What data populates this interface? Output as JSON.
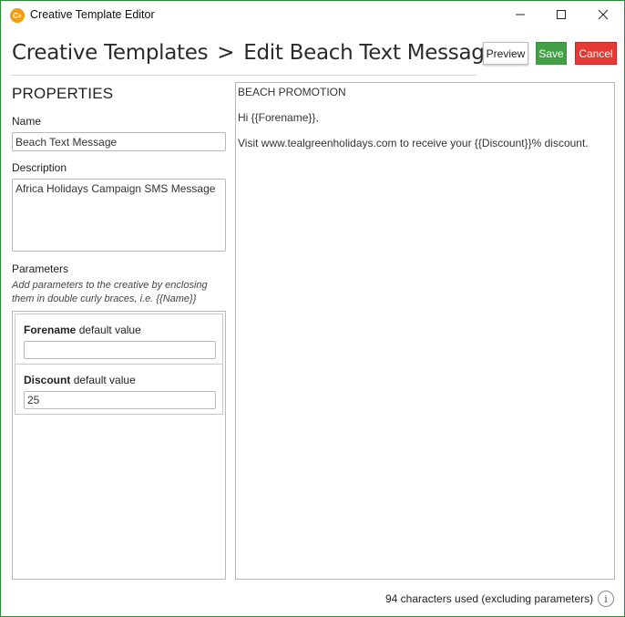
{
  "window": {
    "title": "Creative Template Editor",
    "icon_text": "C+"
  },
  "header": {
    "breadcrumb_root": "Creative Templates",
    "breadcrumb_separator": ">",
    "breadcrumb_current": "Edit Beach Text Message",
    "preview_label": "Preview",
    "save_label": "Save",
    "cancel_label": "Cancel"
  },
  "properties": {
    "heading": "PROPERTIES",
    "name_label": "Name",
    "name_value": "Beach Text Message",
    "description_label": "Description",
    "description_value": "Africa Holidays Campaign SMS Message",
    "parameters_label": "Parameters",
    "parameters_hint": "Add parameters to the creative by enclosing them in double curly braces, i.e. {{Name}}",
    "parameters": [
      {
        "name": "Forename",
        "suffix": "default value",
        "value": ""
      },
      {
        "name": "Discount",
        "suffix": "default value",
        "value": "25"
      }
    ]
  },
  "message": {
    "lines": [
      "BEACH PROMOTION",
      "Hi {{Forename}},",
      "Visit www.tealgreenholidays.com to receive your {{Discount}}% discount."
    ]
  },
  "footer": {
    "char_count_text": "94 characters used (excluding parameters)",
    "info_icon_text": "i"
  },
  "colors": {
    "save": "#43a047",
    "cancel": "#e53935",
    "window_border": "#2e8b3a",
    "app_icon": "#f39c12"
  }
}
